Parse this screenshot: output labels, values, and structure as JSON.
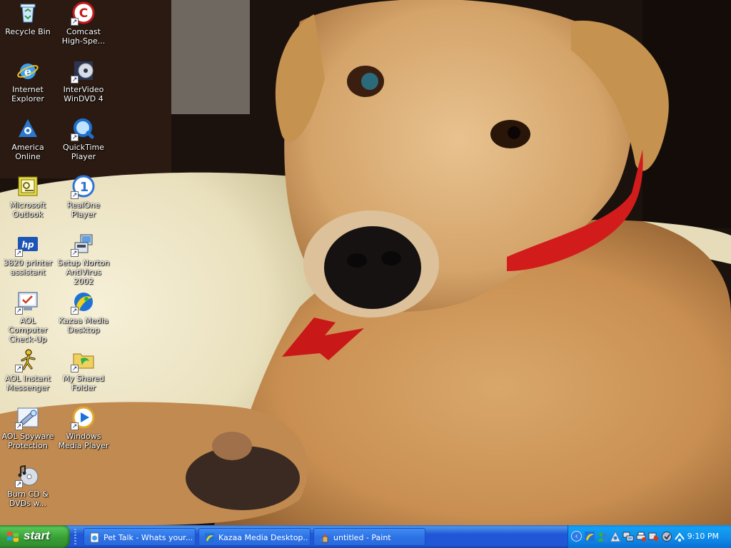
{
  "desktop": {
    "icons": [
      {
        "name": "recycle-bin-icon",
        "label": "Recycle Bin",
        "shortcut": false
      },
      {
        "name": "comcast-icon",
        "label": "Comcast High-Spe...",
        "shortcut": true
      },
      {
        "name": "internet-explorer-icon",
        "label": "Internet Explorer",
        "shortcut": false
      },
      {
        "name": "intervideo-windvd-icon",
        "label": "InterVideo WinDVD 4",
        "shortcut": true
      },
      {
        "name": "america-online-icon",
        "label": "America Online",
        "shortcut": false
      },
      {
        "name": "quicktime-icon",
        "label": "QuickTime Player",
        "shortcut": true
      },
      {
        "name": "outlook-icon",
        "label": "Microsoft Outlook",
        "shortcut": false
      },
      {
        "name": "realone-icon",
        "label": "RealOne Player",
        "shortcut": true
      },
      {
        "name": "hp-printer-icon",
        "label": "3820 printer assistant",
        "shortcut": true
      },
      {
        "name": "norton-setup-icon",
        "label": "Setup Norton AntiVirus 2002",
        "shortcut": true
      },
      {
        "name": "aol-checkup-icon",
        "label": "AOL Computer Check-Up",
        "shortcut": true
      },
      {
        "name": "kazaa-icon",
        "label": "Kazaa Media Desktop",
        "shortcut": true
      },
      {
        "name": "aim-icon",
        "label": "AOL Instant Messenger",
        "shortcut": true
      },
      {
        "name": "shared-folder-icon",
        "label": "My Shared Folder",
        "shortcut": true
      },
      {
        "name": "aol-spyware-icon",
        "label": "AOL Spyware Protection",
        "shortcut": true
      },
      {
        "name": "windows-media-player-icon",
        "label": "Windows Media Player",
        "shortcut": true
      },
      {
        "name": "burn-cd-icon",
        "label": "Burn CD & DVDs w...",
        "shortcut": true
      }
    ]
  },
  "taskbar": {
    "start_label": "start",
    "tasks": [
      {
        "label": "Pet Talk - Whats your...",
        "icon": "ie-document-icon"
      },
      {
        "label": "Kazaa Media Desktop...",
        "icon": "kazaa-icon"
      },
      {
        "label": "untitled - Paint",
        "icon": "paint-icon"
      }
    ],
    "tray": {
      "expand_glyph": "‹",
      "icons": [
        "kazaa-tray-icon",
        "messenger-tray-icon",
        "aol-tray-icon",
        "network-tray-icon",
        "printer-tray-icon",
        "norton-tray-icon",
        "security-tray-icon",
        "volume-tray-icon",
        "connection-tray-icon"
      ],
      "clock": "9:10 PM"
    }
  },
  "colors": {
    "taskbar_blue": "#2157d7",
    "start_green": "#389f37",
    "tray_blue": "#0f8ae9"
  }
}
